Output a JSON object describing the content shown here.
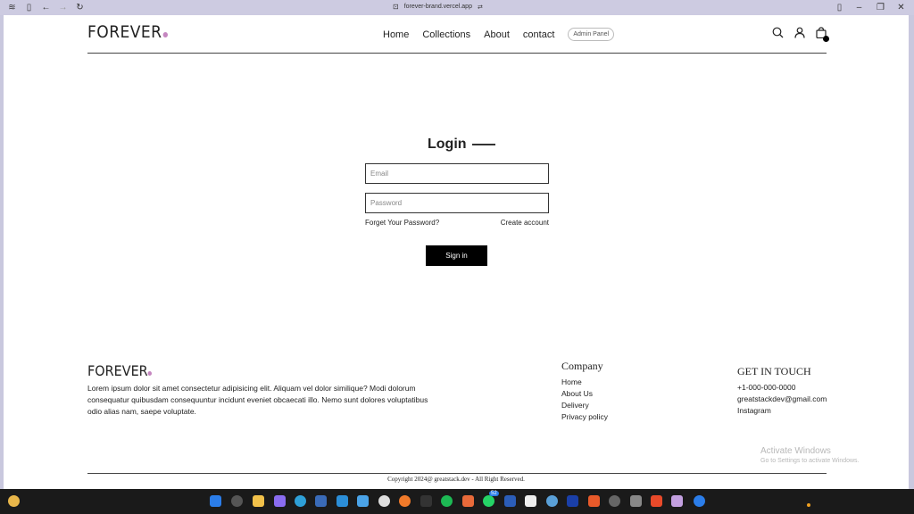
{
  "browser": {
    "url": "forever-brand.vercel.app"
  },
  "header": {
    "logo": "FOREVER",
    "nav": [
      "Home",
      "Collections",
      "About",
      "contact"
    ],
    "admin_label": "Admin Panel"
  },
  "login": {
    "title": "Login",
    "email_placeholder": "Email",
    "password_placeholder": "Password",
    "forgot_label": "Forget Your Password?",
    "create_label": "Create account",
    "signin_label": "Sign in"
  },
  "footer": {
    "logo": "FOREVER",
    "description": "Lorem ipsum dolor sit amet consectetur adipisicing elit. Aliquam vel dolor similique? Modi dolorum consequatur quibusdam consequuntur incidunt eveniet obcaecati illo. Nemo sunt dolores voluptatibus odio alias nam, saepe voluptate.",
    "company_title": "Company",
    "company_links": [
      "Home",
      "About Us",
      "Delivery",
      "Privacy policy"
    ],
    "contact_title": "GET IN TOUCH",
    "contact_items": [
      "+1-000-000-0000",
      "greatstackdev@gmail.com",
      "Instagram"
    ],
    "copyright": "Copyright 2024@ greatstack.dev - All Right Reserved."
  },
  "watermark": {
    "line1": "Activate Windows",
    "line2": "Go to Settings to activate Windows."
  },
  "taskbar": {
    "whatsapp_badge": "52"
  }
}
